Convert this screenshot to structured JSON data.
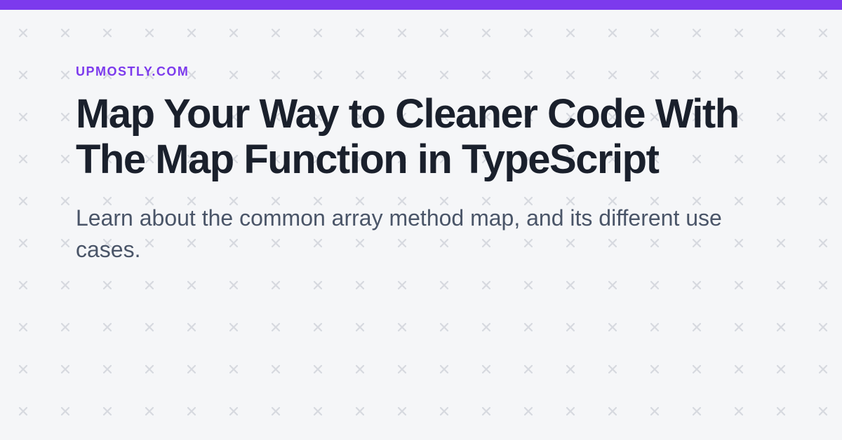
{
  "header": {
    "site_name": "UPMOSTLY.COM"
  },
  "article": {
    "title": "Map Your Way to Cleaner Code With The Map Function in TypeScript",
    "subtitle": "Learn about the common array method map, and its different use cases."
  },
  "colors": {
    "accent": "#7c3aed",
    "heading": "#1a202c",
    "text": "#4a5568",
    "background": "#f5f6f8",
    "pattern": "#d6d9df"
  }
}
